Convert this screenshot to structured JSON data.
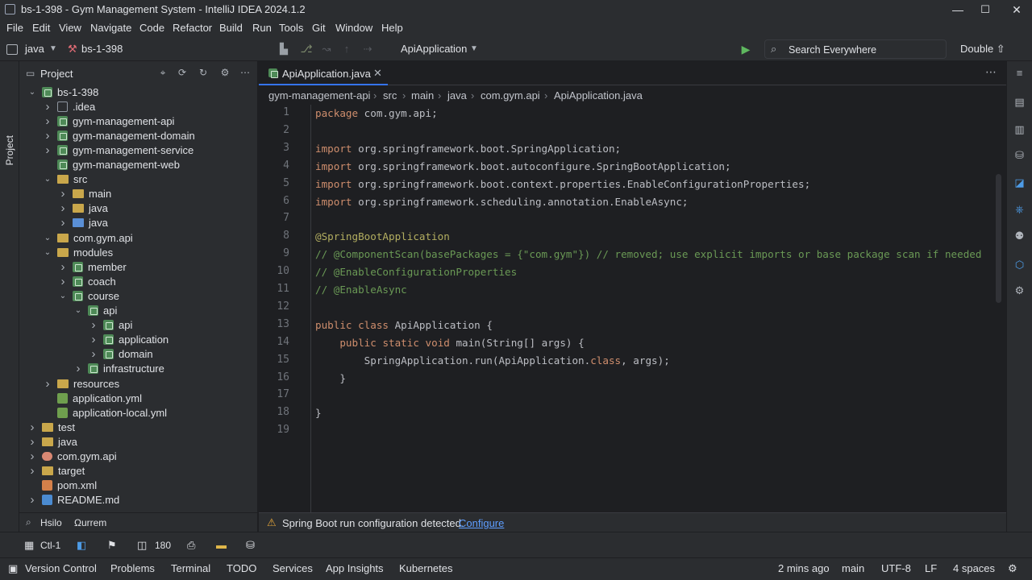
{
  "window": {
    "title": "bs-1-398 - Gym Management System - IntelliJ IDEA 2024.1.2",
    "controls": {
      "minimize": "—",
      "maximize": "☐",
      "close": "✕"
    }
  },
  "menu": [
    "File",
    "Edit",
    "View",
    "Navigate",
    "Code",
    "Refactor",
    "Build",
    "Run",
    "Tools",
    "Git",
    "Window",
    "Help"
  ],
  "toolbar": {
    "lang_label": "java",
    "project_label": "bs-1-398",
    "run_config": "ApiApplication",
    "search_placeholder": "Search Everywhere",
    "double_shift": "Double ⇧"
  },
  "left_strip": {
    "project_label": "Project"
  },
  "project_panel": {
    "title": "Project",
    "tree": [
      {
        "label": "bs-1-398",
        "icon": "module",
        "chevron": "down"
      },
      {
        "label": ".idea",
        "icon": "idea-folder",
        "chevron": "right"
      },
      {
        "label": "gym-management-api",
        "icon": "module",
        "chevron": "right"
      },
      {
        "label": "gym-management-domain",
        "icon": "module",
        "chevron": "right"
      },
      {
        "label": "gym-management-service",
        "icon": "module",
        "chevron": "right"
      },
      {
        "label": "gym-management-web",
        "icon": "module",
        "chevron": ""
      },
      {
        "label": "src",
        "icon": "folder",
        "chevron": "down"
      },
      {
        "label": "main",
        "icon": "folder",
        "chevron": "right"
      },
      {
        "label": "java",
        "icon": "folder",
        "chevron": "right"
      },
      {
        "label": "java",
        "icon": "folder-blue",
        "chevron": "right"
      },
      {
        "label": "com.gym.api",
        "icon": "folder",
        "chevron": "down"
      },
      {
        "label": "modules",
        "icon": "folder",
        "chevron": "down"
      },
      {
        "label": "member",
        "icon": "module",
        "chevron": "right"
      },
      {
        "label": "coach",
        "icon": "module",
        "chevron": "right"
      },
      {
        "label": "course",
        "icon": "module",
        "chevron": "down"
      },
      {
        "label": "api",
        "icon": "module",
        "chevron": "down"
      },
      {
        "label": "api",
        "icon": "module",
        "chevron": "right"
      },
      {
        "label": "application",
        "icon": "module",
        "chevron": "right"
      },
      {
        "label": "domain",
        "icon": "module",
        "chevron": "right"
      },
      {
        "label": "infrastructure",
        "icon": "module",
        "chevron": "right"
      },
      {
        "label": "resources",
        "icon": "folder",
        "chevron": "right"
      },
      {
        "label": "application.yml",
        "icon": "yml",
        "chevron": ""
      },
      {
        "label": "application-local.yml",
        "icon": "yml",
        "chevron": ""
      },
      {
        "label": "test",
        "icon": "folder",
        "chevron": "right"
      },
      {
        "label": "java",
        "icon": "folder",
        "chevron": "right"
      },
      {
        "label": "com.gym.api",
        "icon": "package",
        "chevron": "right"
      },
      {
        "label": "target",
        "icon": "folder",
        "chevron": "right"
      },
      {
        "label": "pom.xml",
        "icon": "xml",
        "chevron": ""
      },
      {
        "label": "README.md",
        "icon": "md",
        "chevron": "right"
      }
    ],
    "bottom_left": "Hsilo",
    "bottom_right": "Ωurrem"
  },
  "editor": {
    "tab_label": "ApiApplication.java",
    "breadcrumbs": [
      "gym-management-api",
      "src",
      "main",
      "java",
      "com.gym.api",
      "ApiApplication.java"
    ],
    "line_numbers": [
      "1",
      "2",
      "3",
      "4",
      "5",
      "6",
      "7",
      "8",
      "9",
      "10",
      "11",
      "12",
      "13",
      "14",
      "15",
      "16",
      "17",
      "18",
      "19"
    ],
    "lines": [
      "package com.gym.api;",
      "",
      "import org.springframework.boot.SpringApplication;",
      "import org.springframework.boot.autoconfigure.SpringBootApplication;",
      "import org.springframework.boot.context.properties.EnableConfigurationProperties;",
      "import org.springframework.scheduling.annotation.EnableAsync;",
      "",
      "@SpringBootApplication",
      "// @ComponentScan(basePackages = {\"com.gym\"}) // removed; use explicit imports or base package scan if needed",
      "// @EnableConfigurationProperties",
      "// @EnableAsync",
      "",
      "public class ApiApplication {",
      "    public static void main(String[] args) {",
      "        SpringApplication.run(ApiApplication.class, args);",
      "    }",
      "",
      "}",
      ""
    ]
  },
  "notification": {
    "text": "Spring Boot run configuration detected.",
    "link": "Configure"
  },
  "tool_row": {
    "item1": "Ctl-1",
    "count": "180"
  },
  "status_bar": {
    "left": [
      "Version Control",
      "Problems",
      "Terminal",
      "TODO",
      "Services",
      "App Insights",
      "Kubernetes"
    ],
    "time": "2 mins ago",
    "branch": "main",
    "encoding": "UTF-8",
    "line_sep": "LF",
    "indent": "4 spaces"
  },
  "colors": {
    "accent": "#3574f0",
    "keyword": "#cf8e6d",
    "annotation": "#b3ae60",
    "comment": "#6a9955",
    "link": "#5e9eff"
  }
}
